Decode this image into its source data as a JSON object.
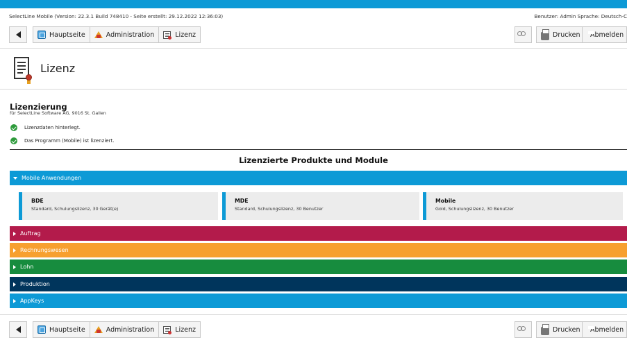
{
  "colors": {
    "accent": "#0d9ad6",
    "auftrag": "#b31b4b",
    "rechnungswesen": "#f7a02f",
    "lohn": "#178c3e",
    "produktion": "#00355c",
    "appkeys": "#0d9ad6",
    "check": "#2e9b3c"
  },
  "version_line": {
    "left": "SelectLine Mobile (Version: 22.3.1 Build 748410 - Seite erstellt: 29.12.2022 12:36:03)",
    "right": "Benutzer: Admin   Sprache: Deutsch-C"
  },
  "toolbar": {
    "back_icon": "back-arrow-icon",
    "home_label": "Hauptseite",
    "home_icon": "home-icon",
    "admin_label": "Administration",
    "admin_icon": "administration-icon",
    "license_label": "Lizenz",
    "license_icon": "certificate-icon",
    "glasses_icon": "glasses-icon",
    "print_label": "Drucken",
    "print_icon": "printer-icon",
    "logout_label": "Abmelden",
    "logout_icon": "floppy-disk-icon"
  },
  "page": {
    "title": "Lizenz",
    "icon": "license-document-icon"
  },
  "licensing": {
    "heading": "Lizenzierung",
    "subheading": "für SelectLine Software AG, 9016 St. Gallen",
    "statuses": [
      "Lizenzdaten hinterlegt.",
      "Das Programm (Mobile) ist lizenziert."
    ]
  },
  "products": {
    "heading": "Lizenzierte Produkte und Module",
    "categories": [
      {
        "label": "Mobile Anwendungen",
        "expanded": true
      },
      {
        "label": "Auftrag",
        "expanded": false
      },
      {
        "label": "Rechnungswesen",
        "expanded": false
      },
      {
        "label": "Lohn",
        "expanded": false
      },
      {
        "label": "Produktion",
        "expanded": false
      },
      {
        "label": "AppKeys",
        "expanded": false
      }
    ],
    "cards": [
      {
        "name": "BDE",
        "desc": "Standard, Schulungslizenz, 30 Gerät(e)"
      },
      {
        "name": "MDE",
        "desc": "Standard, Schulungslizenz, 30 Benutzer"
      },
      {
        "name": "Mobile",
        "desc": "Gold, Schulungslizenz, 30 Benutzer"
      }
    ]
  }
}
